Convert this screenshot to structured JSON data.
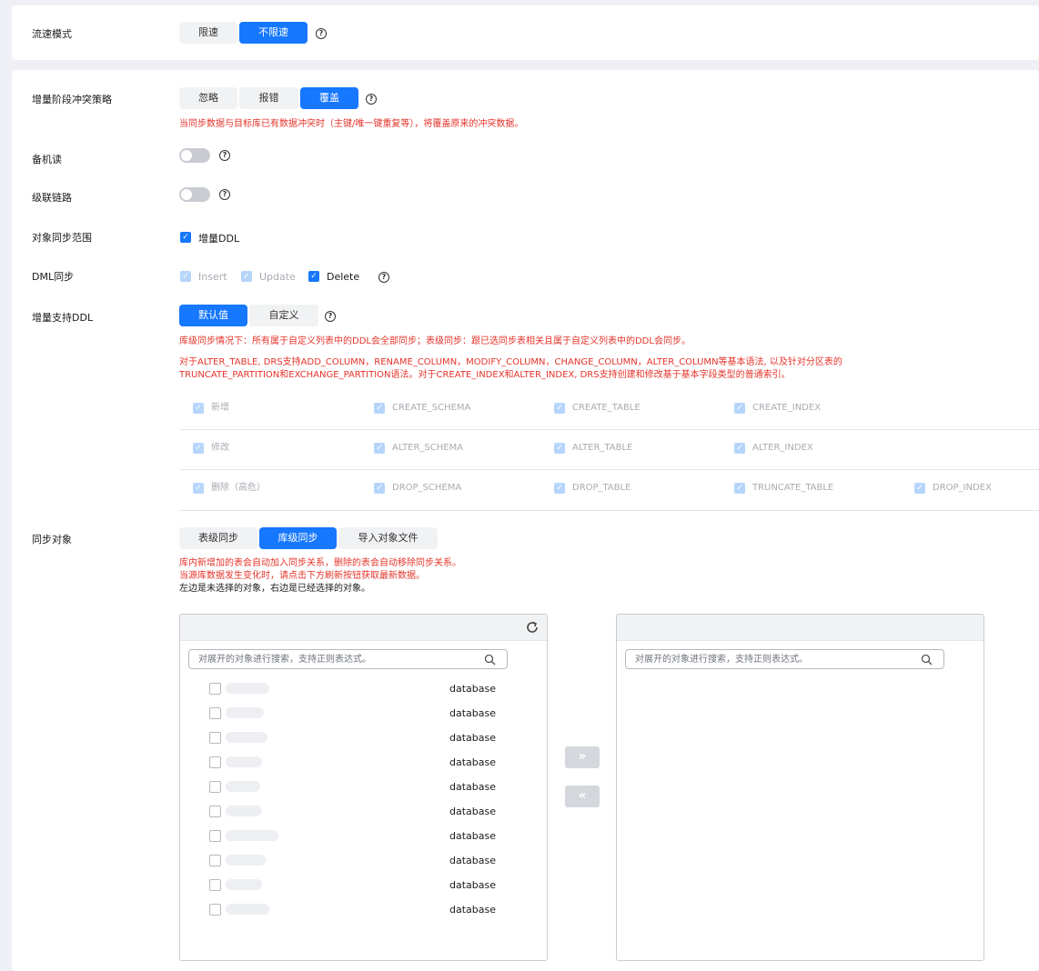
{
  "speed": {
    "label": "流速模式",
    "options": [
      "限速",
      "不限速"
    ],
    "selected": 1
  },
  "conflict": {
    "label": "增量阶段冲突策略",
    "options": [
      "忽略",
      "报错",
      "覆盖"
    ],
    "selected": 2,
    "note": "当同步数据与目标库已有数据冲突时（主键/唯一键重复等），将覆盖原来的冲突数据。"
  },
  "standby_read": {
    "label": "备机读",
    "on": false
  },
  "cascade": {
    "label": "级联链路",
    "on": false
  },
  "scope": {
    "label": "对象同步范围",
    "option": "增量DDL",
    "checked": true
  },
  "dml": {
    "label": "DML同步",
    "items": [
      {
        "label": "Insert",
        "checked": true,
        "disabled": true
      },
      {
        "label": "Update",
        "checked": true,
        "disabled": true
      },
      {
        "label": "Delete",
        "checked": true,
        "disabled": false
      }
    ]
  },
  "ddl_support": {
    "label": "增量支持DDL",
    "options": [
      "默认值",
      "自定义"
    ],
    "selected": 0,
    "note1": "库级同步情况下：所有属于自定义列表中的DDL会全部同步；表级同步：跟已选同步表相关且属于自定义列表中的DDL会同步。",
    "note2_line1": "对于ALTER_TABLE, DRS支持ADD_COLUMN，RENAME_COLUMN，MODIFY_COLUMN，CHANGE_COLUMN，ALTER_COLUMN等基本语法, 以及针对分区表的",
    "note2_line2": "TRUNCATE_PARTITION和EXCHANGE_PARTITION语法。对于CREATE_INDEX和ALTER_INDEX, DRS支持创建和修改基于基本字段类型的普通索引。",
    "rows": [
      [
        "新增",
        "CREATE_SCHEMA",
        "CREATE_TABLE",
        "CREATE_INDEX"
      ],
      [
        "修改",
        "ALTER_SCHEMA",
        "ALTER_TABLE",
        "ALTER_INDEX"
      ],
      [
        "删除（高危）",
        "DROP_SCHEMA",
        "DROP_TABLE",
        "TRUNCATE_TABLE",
        "DROP_INDEX"
      ]
    ]
  },
  "sync_objects": {
    "label": "同步对象",
    "options": [
      "表级同步",
      "库级同步",
      "导入对象文件"
    ],
    "selected": 1,
    "note_line1": "库内新增加的表会自动加入同步关系，删除的表会自动移除同步关系。",
    "note_line2": "当源库数据发生变化时，请点击下方刷新按钮获取最新数据。",
    "hint": "左边是未选择的对象，右边是已经选择的对象。",
    "search_placeholder": "对展开的对象进行搜索，支持正则表达式。",
    "items": [
      {
        "type": "database"
      },
      {
        "type": "database"
      },
      {
        "type": "database"
      },
      {
        "type": "database"
      },
      {
        "type": "database"
      },
      {
        "type": "database"
      },
      {
        "type": "database"
      },
      {
        "type": "database"
      },
      {
        "type": "database"
      },
      {
        "type": "database"
      }
    ],
    "icons": {
      "refresh": "refresh-icon",
      "search": "search-icon",
      "move_right": "double-chevron-right-icon",
      "move_left": "double-chevron-left-icon"
    }
  },
  "colors": {
    "primary": "#1677ff",
    "danger": "#e5342b",
    "disabled_check": "#b6d5fb"
  }
}
